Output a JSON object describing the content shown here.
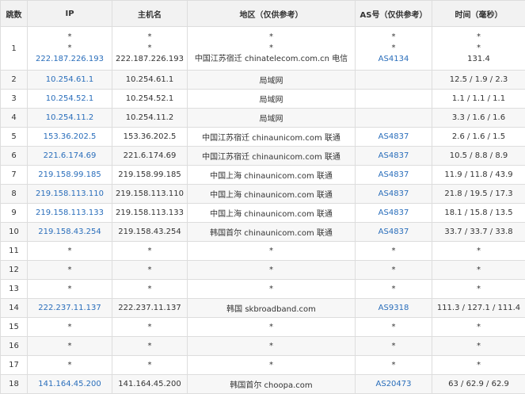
{
  "headers": {
    "hop": "跳数",
    "ip": "IP",
    "host": "主机名",
    "region": "地区（仅供参考）",
    "as": "AS号（仅供参考）",
    "time": "时间（毫秒）"
  },
  "row1": {
    "hop": "1",
    "ip": [
      "*",
      "*",
      "222.187.226.193"
    ],
    "host": [
      "*",
      "*",
      "222.187.226.193"
    ],
    "region": [
      "*",
      "*",
      "中国江苏宿迁 chinatelecom.com.cn 电信"
    ],
    "as": [
      "*",
      "*",
      "AS4134"
    ],
    "time": [
      "*",
      "*",
      "131.4"
    ]
  },
  "rows": [
    {
      "hop": "2",
      "ip": "10.254.61.1",
      "host": "10.254.61.1",
      "region": "局域网",
      "as": "",
      "time": "12.5 / 1.9 / 2.3"
    },
    {
      "hop": "3",
      "ip": "10.254.52.1",
      "host": "10.254.52.1",
      "region": "局域网",
      "as": "",
      "time": "1.1 / 1.1 / 1.1"
    },
    {
      "hop": "4",
      "ip": "10.254.11.2",
      "host": "10.254.11.2",
      "region": "局域网",
      "as": "",
      "time": "3.3 / 1.6 / 1.6"
    },
    {
      "hop": "5",
      "ip": "153.36.202.5",
      "host": "153.36.202.5",
      "region": "中国江苏宿迁 chinaunicom.com 联通",
      "as": "AS4837",
      "time": "2.6 / 1.6 / 1.5"
    },
    {
      "hop": "6",
      "ip": "221.6.174.69",
      "host": "221.6.174.69",
      "region": "中国江苏宿迁 chinaunicom.com 联通",
      "as": "AS4837",
      "time": "10.5 / 8.8 / 8.9"
    },
    {
      "hop": "7",
      "ip": "219.158.99.185",
      "host": "219.158.99.185",
      "region": "中国上海 chinaunicom.com 联通",
      "as": "AS4837",
      "time": "11.9 / 11.8 / 43.9"
    },
    {
      "hop": "8",
      "ip": "219.158.113.110",
      "host": "219.158.113.110",
      "region": "中国上海 chinaunicom.com 联通",
      "as": "AS4837",
      "time": "21.8 / 19.5 / 17.3"
    },
    {
      "hop": "9",
      "ip": "219.158.113.133",
      "host": "219.158.113.133",
      "region": "中国上海 chinaunicom.com 联通",
      "as": "AS4837",
      "time": "18.1 / 15.8 / 13.5"
    },
    {
      "hop": "10",
      "ip": "219.158.43.254",
      "host": "219.158.43.254",
      "region": "韩国首尔 chinaunicom.com 联通",
      "as": "AS4837",
      "time": "33.7 / 33.7 / 33.8"
    },
    {
      "hop": "11",
      "ip": "*",
      "host": "*",
      "region": "*",
      "as": "*",
      "time": "*"
    },
    {
      "hop": "12",
      "ip": "*",
      "host": "*",
      "region": "*",
      "as": "*",
      "time": "*"
    },
    {
      "hop": "13",
      "ip": "*",
      "host": "*",
      "region": "*",
      "as": "*",
      "time": "*"
    },
    {
      "hop": "14",
      "ip": "222.237.11.137",
      "host": "222.237.11.137",
      "region": "韩国 skbroadband.com",
      "as": "AS9318",
      "time": "111.3 / 127.1 / 111.4"
    },
    {
      "hop": "15",
      "ip": "*",
      "host": "*",
      "region": "*",
      "as": "*",
      "time": "*"
    },
    {
      "hop": "16",
      "ip": "*",
      "host": "*",
      "region": "*",
      "as": "*",
      "time": "*"
    },
    {
      "hop": "17",
      "ip": "*",
      "host": "*",
      "region": "*",
      "as": "*",
      "time": "*"
    },
    {
      "hop": "18",
      "ip": "141.164.45.200",
      "host": "141.164.45.200",
      "region": "韩国首尔 choopa.com",
      "as": "AS20473",
      "time": "63 / 62.9 / 62.9"
    }
  ],
  "colors": {
    "link": "#2a6ebb",
    "header_bg": "#f2f2f2",
    "border": "#dddddd"
  }
}
